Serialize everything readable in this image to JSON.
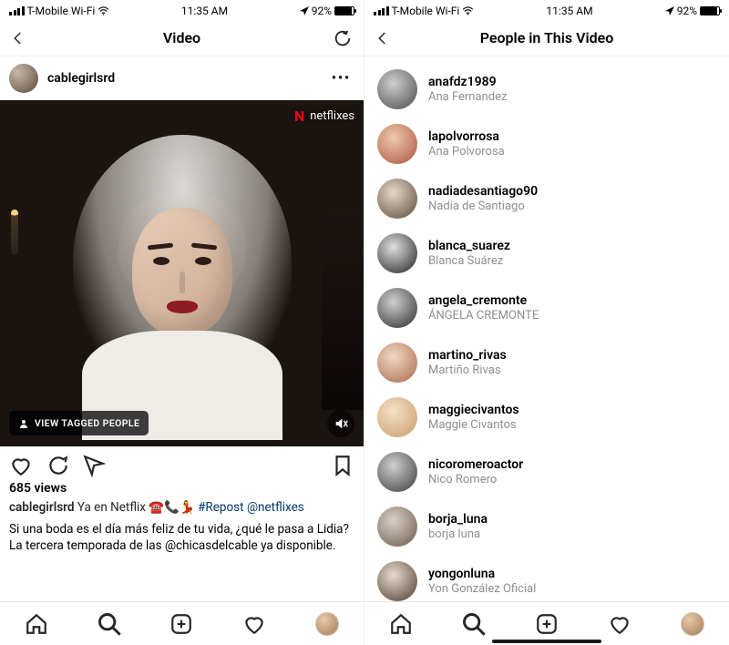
{
  "status": {
    "carrier": "T-Mobile Wi-Fi",
    "time": "11:35 AM",
    "battery_pct": "92%"
  },
  "left": {
    "header_title": "Video",
    "account_username": "cablegirlsrd",
    "video_overlay_account": "netflixes",
    "tagged_pill_label": "VIEW TAGGED PEOPLE",
    "views_text": "685 views",
    "caption_username": "cablegirlsrd",
    "caption_inline": "Ya en Netflix ☎️📞💃 ",
    "caption_hashtag": "#Repost",
    "caption_mention": "@netflixes",
    "caption_body_1": "Si una boda es el día más feliz de tu vida, ¿qué le pasa a Lidia? La tercera temporada de  las ",
    "caption_body_link": "@chicasdelcable",
    "caption_body_2": " ya disponible."
  },
  "right": {
    "header_title": "People in This Video",
    "people": [
      {
        "username": "anafdz1989",
        "name": "Ana Fernandez"
      },
      {
        "username": "lapolvorrosa",
        "name": "Ana Polvorosa"
      },
      {
        "username": "nadiadesantiago90",
        "name": "Nadia de Santiago"
      },
      {
        "username": "blanca_suarez",
        "name": "Blanca Suárez"
      },
      {
        "username": "angela_cremonte",
        "name": "ÁNGELA CREMONTE"
      },
      {
        "username": "martino_rivas",
        "name": "Martiño Rivas"
      },
      {
        "username": "maggiecivantos",
        "name": "Maggie Civantos"
      },
      {
        "username": "nicoromeroactor",
        "name": "Nico Romero"
      },
      {
        "username": "borja_luna",
        "name": "borja luna"
      },
      {
        "username": "yongonluna",
        "name": "Yon González Oficial"
      }
    ]
  }
}
